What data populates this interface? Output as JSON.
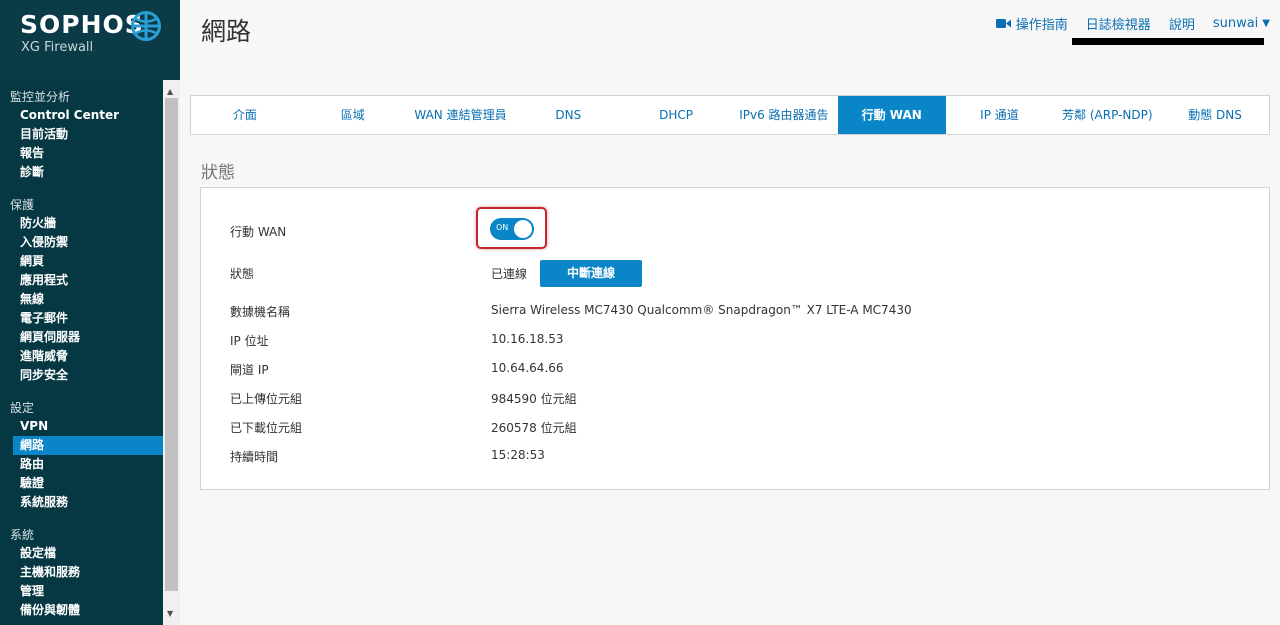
{
  "brand": {
    "name": "SOPHOS",
    "product": "XG Firewall",
    "accent": "#0a86c8",
    "sidebar_bg": "#063844"
  },
  "sidebar": {
    "groups": [
      {
        "title": "監控並分析",
        "items": [
          "Control Center",
          "目前活動",
          "報告",
          "診斷"
        ]
      },
      {
        "title": "保護",
        "items": [
          "防火牆",
          "入侵防禦",
          "網頁",
          "應用程式",
          "無線",
          "電子郵件",
          "網頁伺服器",
          "進階威脅",
          "同步安全"
        ]
      },
      {
        "title": "設定",
        "items": [
          "VPN",
          "網路",
          "路由",
          "驗證",
          "系統服務"
        ]
      },
      {
        "title": "系統",
        "items": [
          "設定檔",
          "主機和服務",
          "管理",
          "備份與韌體"
        ]
      }
    ],
    "active_item": "網路"
  },
  "header": {
    "title": "網路",
    "links": {
      "guide": "操作指南",
      "log_viewer": "日誌檢視器",
      "help": "說明",
      "user": "sunwai"
    },
    "guide_icon": "video-camera-icon"
  },
  "tabs": [
    {
      "label": "介面",
      "active": false
    },
    {
      "label": "區域",
      "active": false
    },
    {
      "label": "WAN 連結管理員",
      "active": false
    },
    {
      "label": "DNS",
      "active": false
    },
    {
      "label": "DHCP",
      "active": false
    },
    {
      "label": "IPv6 路由器通告",
      "active": false
    },
    {
      "label": "行動 WAN",
      "active": true
    },
    {
      "label": "IP 通道",
      "active": false
    },
    {
      "label": "芳鄰 (ARP-NDP)",
      "active": false
    },
    {
      "label": "動態 DNS",
      "active": false
    }
  ],
  "section": {
    "title": "狀態",
    "mobile_wan_label": "行動 WAN",
    "toggle_text": "ON",
    "status_label": "狀態",
    "status_value": "已連線",
    "disconnect_button": "中斷連線",
    "fields": [
      {
        "label": "數據機名稱",
        "value": "Sierra Wireless MC7430 Qualcomm® Snapdragon™ X7 LTE-A MC7430"
      },
      {
        "label": "IP 位址",
        "value": "10.16.18.53"
      },
      {
        "label": "閘道 IP",
        "value": "10.64.64.66"
      },
      {
        "label": "已上傳位元組",
        "value": "984590 位元組"
      },
      {
        "label": "已下載位元組",
        "value": "260578 位元組"
      },
      {
        "label": "持續時間",
        "value": "15:28:53"
      }
    ]
  }
}
